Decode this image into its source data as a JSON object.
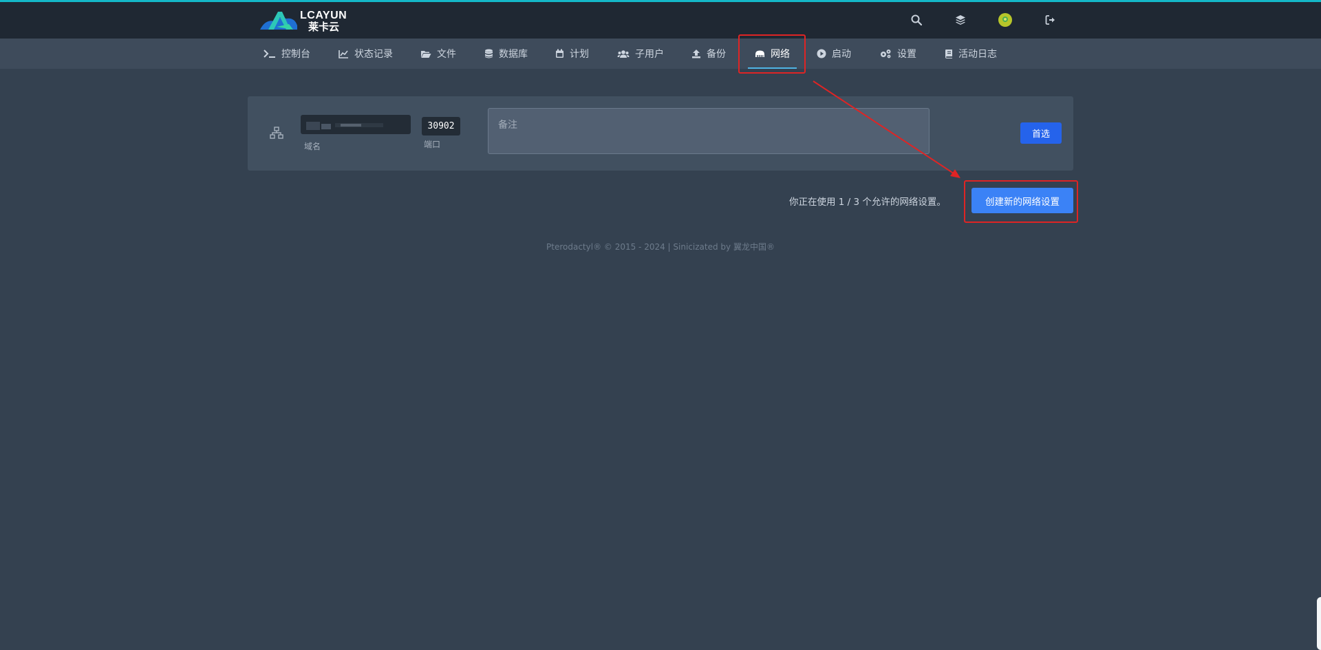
{
  "brand": {
    "logo_text": "LCAYUN",
    "logo_sub": "莱卡云",
    "accent": "#14b8c8"
  },
  "header": {
    "icons": [
      "search-icon",
      "layers-icon",
      "avatar",
      "logout-icon"
    ]
  },
  "nav": {
    "items": [
      {
        "label": "控制台",
        "icon": "terminal-icon"
      },
      {
        "label": "状态记录",
        "icon": "chart-line-icon"
      },
      {
        "label": "文件",
        "icon": "folder-open-icon"
      },
      {
        "label": "数据库",
        "icon": "database-icon"
      },
      {
        "label": "计划",
        "icon": "calendar-icon"
      },
      {
        "label": "子用户",
        "icon": "users-icon"
      },
      {
        "label": "备份",
        "icon": "upload-icon"
      },
      {
        "label": "网络",
        "icon": "network-wired-icon",
        "active": true
      },
      {
        "label": "启动",
        "icon": "play-circle-icon"
      },
      {
        "label": "设置",
        "icon": "cogs-icon"
      },
      {
        "label": "活动日志",
        "icon": "book-icon"
      }
    ]
  },
  "allocation": {
    "domain_label": "域名",
    "port": "30902",
    "port_label": "端口",
    "notes_placeholder": "备注",
    "primary_label": "首选"
  },
  "usage_text": "你正在使用 1 / 3 个允许的网络设置。",
  "create_button_label": "创建新的网络设置",
  "footer_text": "Pterodactyl® © 2015 - 2024 | Sinicizated by 翼龙中国®",
  "colors": {
    "highlight": "#e02424",
    "primary_button": "#2563eb",
    "create_button": "#3b82f6"
  }
}
